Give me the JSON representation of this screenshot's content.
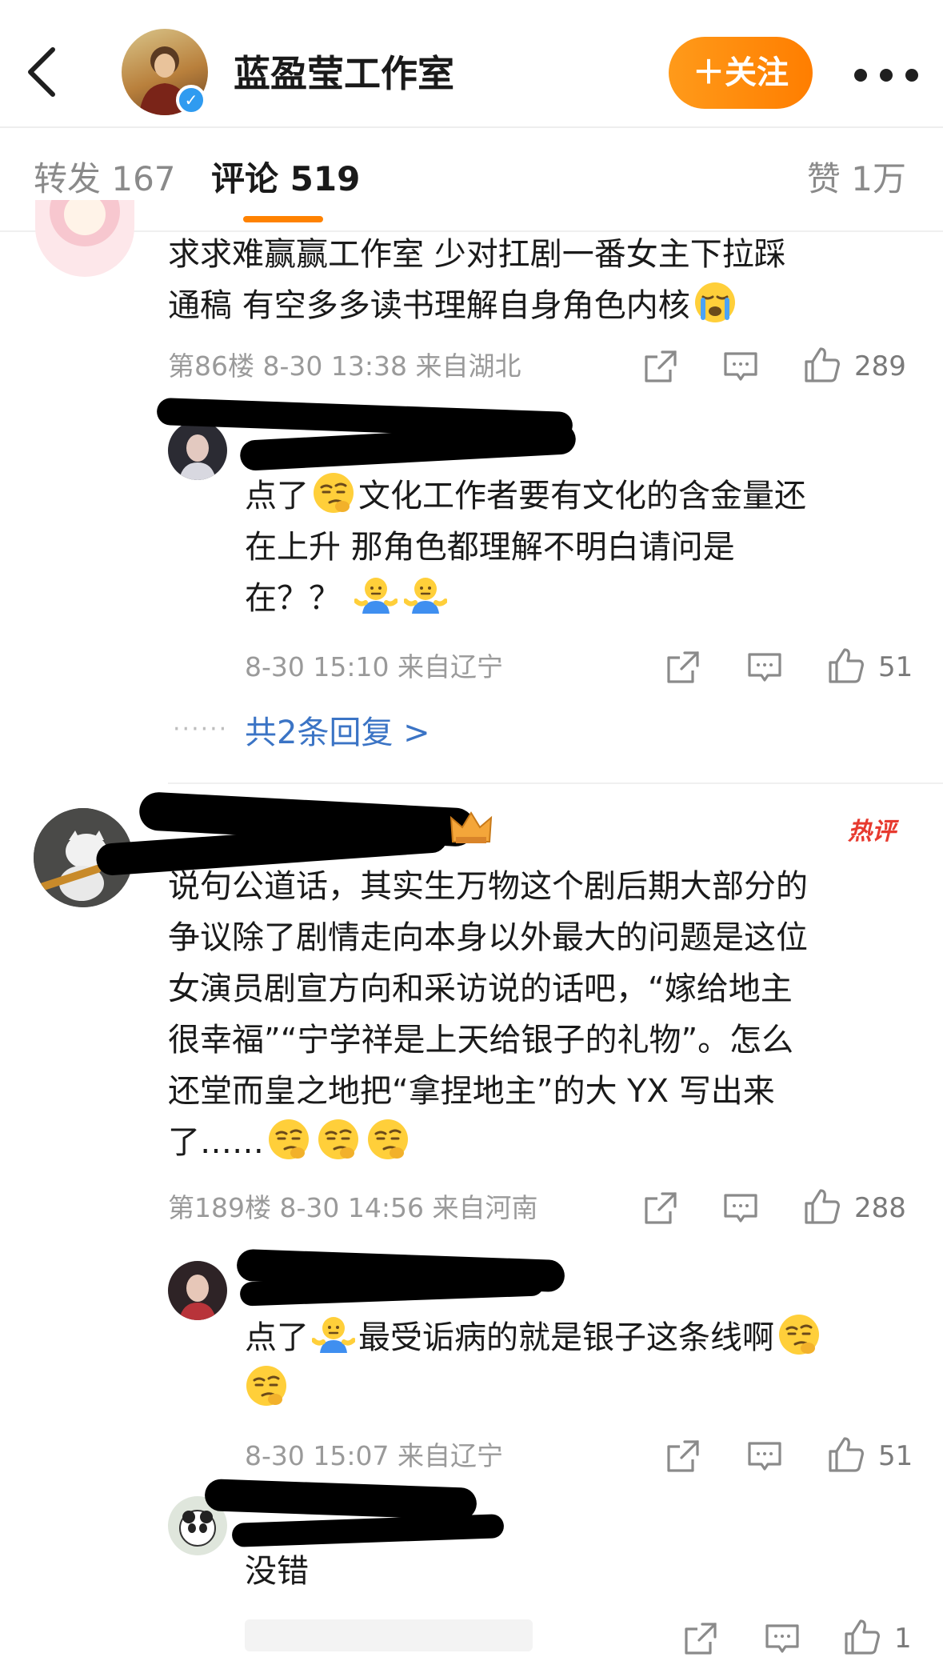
{
  "header": {
    "account_name": "蓝盈莹工作室",
    "follow_label": "＋关注"
  },
  "tabs": {
    "repost": "转发 167",
    "comments": "评论 519",
    "likes": "赞 1万"
  },
  "comments": [
    {
      "text_line1": "求求难赢赢工作室 少对扛剧一番女主下拉踩",
      "text_line2": "通稿 有空多多读书理解自身角色内核",
      "meta": "第86楼 8-30 13:38 来自湖北",
      "likes": "289",
      "replies": [
        {
          "text_line1": "点了",
          "text_line1b": "文化工作者要有文化的含金量还",
          "text_line2": "在上升 那角色都理解不明白请问是",
          "text_line3": "在？？",
          "meta": "8-30 15:10 来自辽宁",
          "likes": "51"
        }
      ],
      "more_replies": "共2条回复 >"
    },
    {
      "hot_tag": "热评",
      "text_lines": [
        "说句公道话，其实生万物这个剧后期大部分的",
        "争议除了剧情走向本身以外最大的问题是这位",
        "女演员剧宣方向和采访说的话吧，“嫁给地主",
        "很幸福”“宁学祥是上天给银子的礼物”。怎么",
        "还堂而皇之地把“拿捏地主”的大 YX 写出来",
        "了……"
      ],
      "meta": "第189楼 8-30 14:56 来自河南",
      "likes": "288",
      "replies": [
        {
          "text_prefix": "点了",
          "text_main": "最受诟病的就是银子这条线啊",
          "meta": "8-30 15:07 来自辽宁",
          "likes": "51"
        },
        {
          "text": "没错",
          "likes": "1"
        }
      ]
    }
  ],
  "colors": {
    "accent": "#ff8200",
    "link": "#3b74c5",
    "meta": "#9a9a9a",
    "hot": "#e73a2f"
  },
  "icons": [
    "back-icon",
    "verified-icon",
    "more-icon",
    "share-icon",
    "comment-icon",
    "like-icon",
    "emoji-smirk",
    "emoji-shrug",
    "emoji-crying"
  ]
}
